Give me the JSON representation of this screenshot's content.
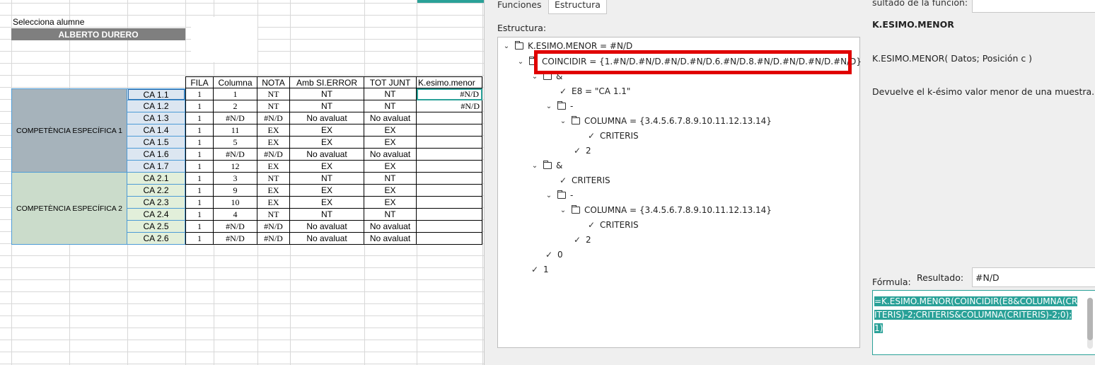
{
  "sheet": {
    "student_label": "Selecciona alumne",
    "student_name": "ALBERTO DURERO",
    "headers": [
      "FILA",
      "Columna",
      "NOTA",
      "Amb SI.ERROR",
      "TOT JUNT",
      "K.esimo.menor"
    ],
    "groups": [
      {
        "label": "COMPETÈNCIA ESPECÍFICA 1"
      },
      {
        "label": "COMPETÈNCIA ESPECÍFICA 2"
      }
    ],
    "rows": [
      {
        "ca": "CA 1.1",
        "fila": "1",
        "col": "1",
        "nota": "NT",
        "err": "NT",
        "tot": "NT",
        "k": "#N/D"
      },
      {
        "ca": "CA 1.2",
        "fila": "1",
        "col": "2",
        "nota": "NT",
        "err": "NT",
        "tot": "NT",
        "k": "#N/D"
      },
      {
        "ca": "CA 1.3",
        "fila": "1",
        "col": "#N/D",
        "nota": "#N/D",
        "err": "No avaluat",
        "tot": "No avaluat",
        "k": ""
      },
      {
        "ca": "CA 1.4",
        "fila": "1",
        "col": "11",
        "nota": "EX",
        "err": "EX",
        "tot": "EX",
        "k": ""
      },
      {
        "ca": "CA 1.5",
        "fila": "1",
        "col": "5",
        "nota": "EX",
        "err": "EX",
        "tot": "EX",
        "k": ""
      },
      {
        "ca": "CA 1.6",
        "fila": "1",
        "col": "#N/D",
        "nota": "#N/D",
        "err": "No avaluat",
        "tot": "No avaluat",
        "k": ""
      },
      {
        "ca": "CA 1.7",
        "fila": "1",
        "col": "12",
        "nota": "EX",
        "err": "EX",
        "tot": "EX",
        "k": ""
      },
      {
        "ca": "CA 2.1",
        "fila": "1",
        "col": "3",
        "nota": "NT",
        "err": "NT",
        "tot": "NT",
        "k": ""
      },
      {
        "ca": "CA 2.2",
        "fila": "1",
        "col": "9",
        "nota": "EX",
        "err": "EX",
        "tot": "EX",
        "k": ""
      },
      {
        "ca": "CA 2.3",
        "fila": "1",
        "col": "10",
        "nota": "EX",
        "err": "EX",
        "tot": "EX",
        "k": ""
      },
      {
        "ca": "CA 2.4",
        "fila": "1",
        "col": "4",
        "nota": "NT",
        "err": "NT",
        "tot": "NT",
        "k": ""
      },
      {
        "ca": "CA 2.5",
        "fila": "1",
        "col": "#N/D",
        "nota": "#N/D",
        "err": "No avaluat",
        "tot": "No avaluat",
        "k": ""
      },
      {
        "ca": "CA 2.6",
        "fila": "1",
        "col": "#N/D",
        "nota": "#N/D",
        "err": "No avaluat",
        "tot": "No avaluat",
        "k": ""
      }
    ]
  },
  "dialog": {
    "tabs": [
      "Funciones",
      "Estructura"
    ],
    "structure_label": "Estructura:",
    "result_label": "sultado de la función:",
    "function_name": "K.ESIMO.MENOR",
    "function_signature": "K.ESIMO.MENOR( Datos; Posición c )",
    "function_desc": "Devuelve el k-ésimo valor menor de una muestra.",
    "formula_label": "Fórmula:",
    "resultado_label": "Resultado:",
    "resultado_value": "#N/D",
    "formula_text": "=K.ESIMO.MENOR(COINCIDIR(E8&COLUMNA(CRITERIS)-2;CRITERIS&COLUMNA(CRITERIS)-2;0);1)",
    "tree": [
      {
        "label": "K.ESIMO.MENOR = #N/D",
        "kind": "folder"
      },
      {
        "label": "COINCIDIR = {1.#N/D.#N/D.#N/D.#N/D.6.#N/D.8.#N/D.#N/D.#N/D.#N/D}",
        "kind": "folder"
      },
      {
        "label": "&",
        "kind": "folder"
      },
      {
        "label": "E8 = \"CA 1.1\"",
        "kind": "leaf"
      },
      {
        "label": "-",
        "kind": "folder"
      },
      {
        "label": "COLUMNA = {3.4.5.6.7.8.9.10.11.12.13.14}",
        "kind": "folder"
      },
      {
        "label": "CRITERIS",
        "kind": "leaf"
      },
      {
        "label": "2",
        "kind": "leaf"
      },
      {
        "label": "&",
        "kind": "folder"
      },
      {
        "label": "CRITERIS",
        "kind": "leaf"
      },
      {
        "label": "-",
        "kind": "folder"
      },
      {
        "label": "COLUMNA = {3.4.5.6.7.8.9.10.11.12.13.14}",
        "kind": "folder"
      },
      {
        "label": "CRITERIS",
        "kind": "leaf"
      },
      {
        "label": "2",
        "kind": "leaf"
      },
      {
        "label": "0",
        "kind": "leaf"
      },
      {
        "label": "1",
        "kind": "leaf"
      }
    ],
    "highlight_color": "#e00000",
    "selection_color": "#2aa198"
  }
}
